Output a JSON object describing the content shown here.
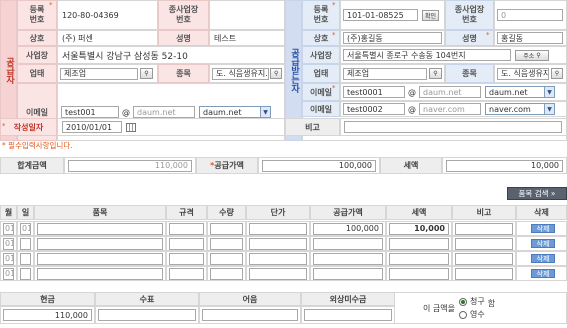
{
  "supplier": {
    "sidebar_label": "공급자",
    "reg_no_label": "등록\n번호",
    "reg_no": "120-80-04369",
    "branch_no_label": "종사업장\n번호",
    "company_label": "상호",
    "company": "(주) 퍼센",
    "name_label": "성명",
    "name": "테스트",
    "address_label": "사업장",
    "address": "서울특별시 강남구 삼성동 52-10",
    "biz_type_label": "업태",
    "biz_type": "제조업",
    "biz_item_label": "종목",
    "biz_item": "도. 식음생유지.",
    "email_label": "이메일",
    "email_id": "test001",
    "email_domain": "daum.net",
    "email_select": "daum.net"
  },
  "buyer": {
    "sidebar_label": "공급받는자",
    "reg_no_label": "등록\n번호",
    "reg_no": "101-01-08525",
    "confirm_label": "확인",
    "branch_no_label": "종사업장\n번호",
    "branch_no": "0",
    "company_label": "상호",
    "company": "(주)홍길동",
    "name_label": "성명",
    "name": "홍길동",
    "address_label": "사업장",
    "address": "서울특별시 종로구 수송동 104번지",
    "address_btn": "주소",
    "biz_type_label": "업태",
    "biz_type": "제조업",
    "biz_item_label": "종목",
    "biz_item": "도. 식음생유지.",
    "email1_label": "이메일",
    "email1_id": "test0001",
    "email1_domain": "daum.net",
    "email1_select": "daum.net",
    "email2_label": "이메일",
    "email2_id": "test0002",
    "email2_domain": "naver.com",
    "email2_select": "naver.com"
  },
  "write_date_label": "작성일자",
  "write_date": "2010/01/01",
  "remarks_label": "비고",
  "required_note": "* 필수입력사항입니다.",
  "totals": {
    "total_label": "합계금액",
    "total": "110,000",
    "supply_label": "공급가액",
    "supply": "100,000",
    "tax_label": "세액",
    "tax": "10,000"
  },
  "item_search_btn": "품목 검색 »",
  "items_table": {
    "headers": [
      "월",
      "일",
      "품목",
      "규격",
      "수량",
      "단가",
      "공급가액",
      "세액",
      "비고",
      "삭제"
    ],
    "rows": [
      {
        "month": "01",
        "day": "01",
        "supply": "100,000",
        "tax": "10,000",
        "delete": "삭제"
      },
      {
        "month": "01",
        "day": "",
        "supply": "",
        "tax": "",
        "delete": "삭제"
      },
      {
        "month": "01",
        "day": "",
        "supply": "",
        "tax": "",
        "delete": "삭제"
      },
      {
        "month": "01",
        "day": "",
        "supply": "",
        "tax": "",
        "delete": "삭제"
      }
    ]
  },
  "payment": {
    "headers": [
      "현금",
      "수표",
      "어음",
      "외상미수금"
    ],
    "cash": "110,000",
    "receipt_label": "이 금액을",
    "option_claim": "청구",
    "option_receipt": "영수",
    "suffix": "함"
  }
}
